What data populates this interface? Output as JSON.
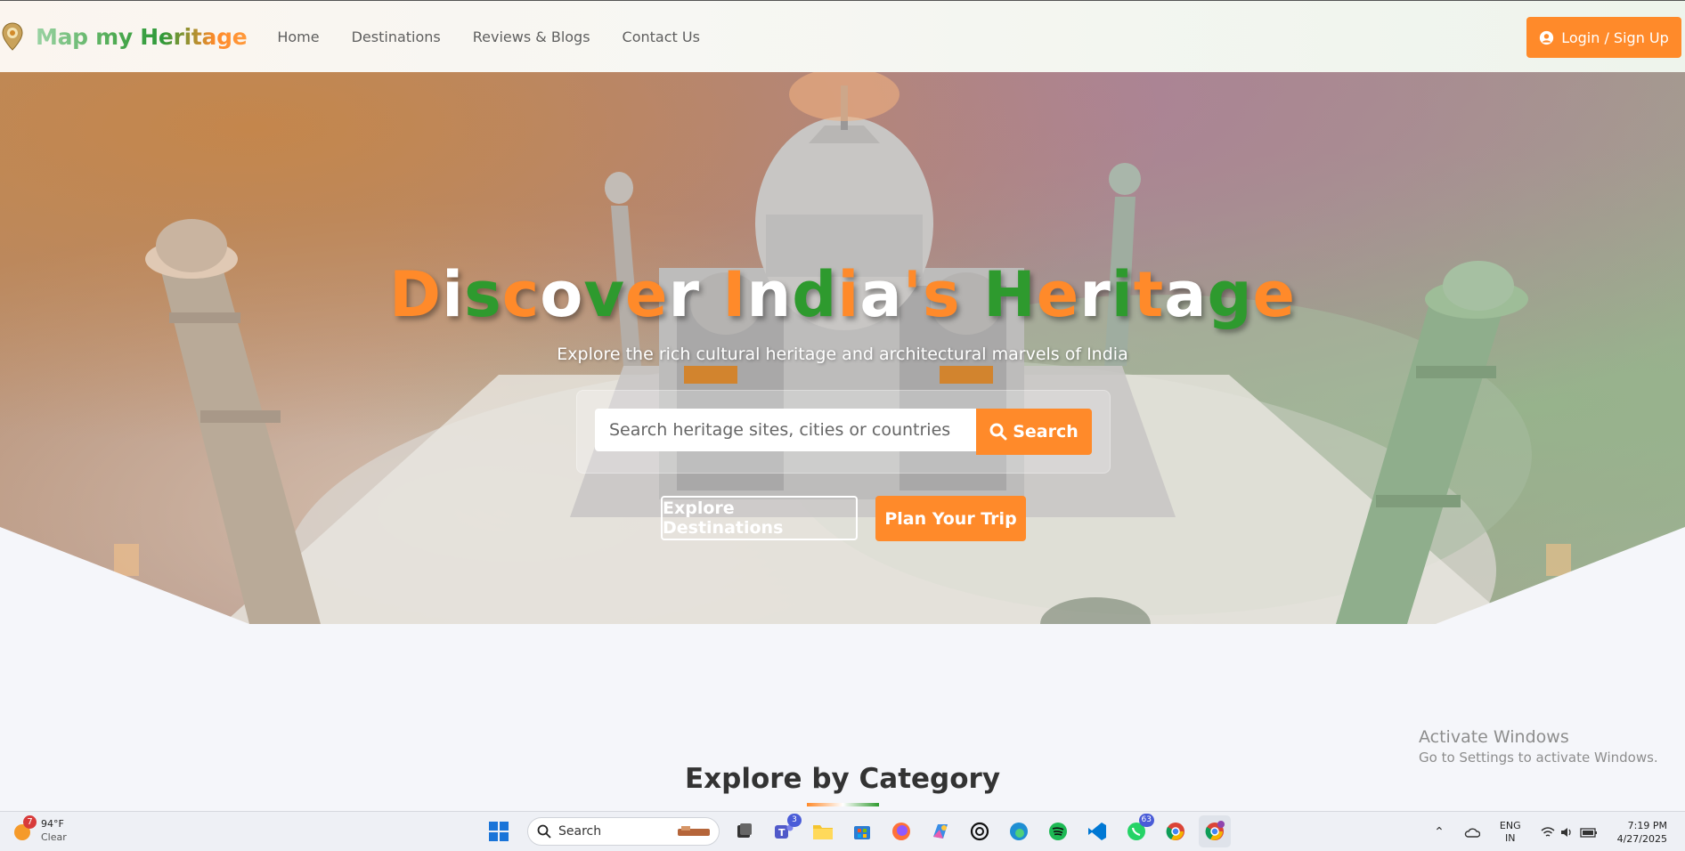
{
  "brand": {
    "name": "Map my Heritage"
  },
  "nav": {
    "links": [
      "Home",
      "Destinations",
      "Reviews & Blogs",
      "Contact Us"
    ],
    "login_label": "Login / Sign Up"
  },
  "hero": {
    "title": "Discover India's Heritage",
    "subtitle": "Explore the rich cultural heritage and architectural marvels of India",
    "search_placeholder": "Search heritage sites, cities or countries",
    "search_label": "Search",
    "explore_label": "Explore Destinations",
    "plan_label": "Plan Your Trip"
  },
  "category_section": {
    "title": "Explore by Category"
  },
  "watermark": {
    "line1": "Activate Windows",
    "line2": "Go to Settings to activate Windows."
  },
  "taskbar": {
    "weather_temp": "94°F",
    "weather_condition": "Clear",
    "weather_badge": "7",
    "search_label": "Search",
    "teams_badge": "3",
    "whatsapp_badge": "63",
    "lang_line1": "ENG",
    "lang_line2": "IN",
    "time": "7:19 PM",
    "date": "4/27/2025"
  },
  "colors": {
    "accent_orange": "#ff8a2a",
    "accent_green": "#2e9a2e"
  }
}
